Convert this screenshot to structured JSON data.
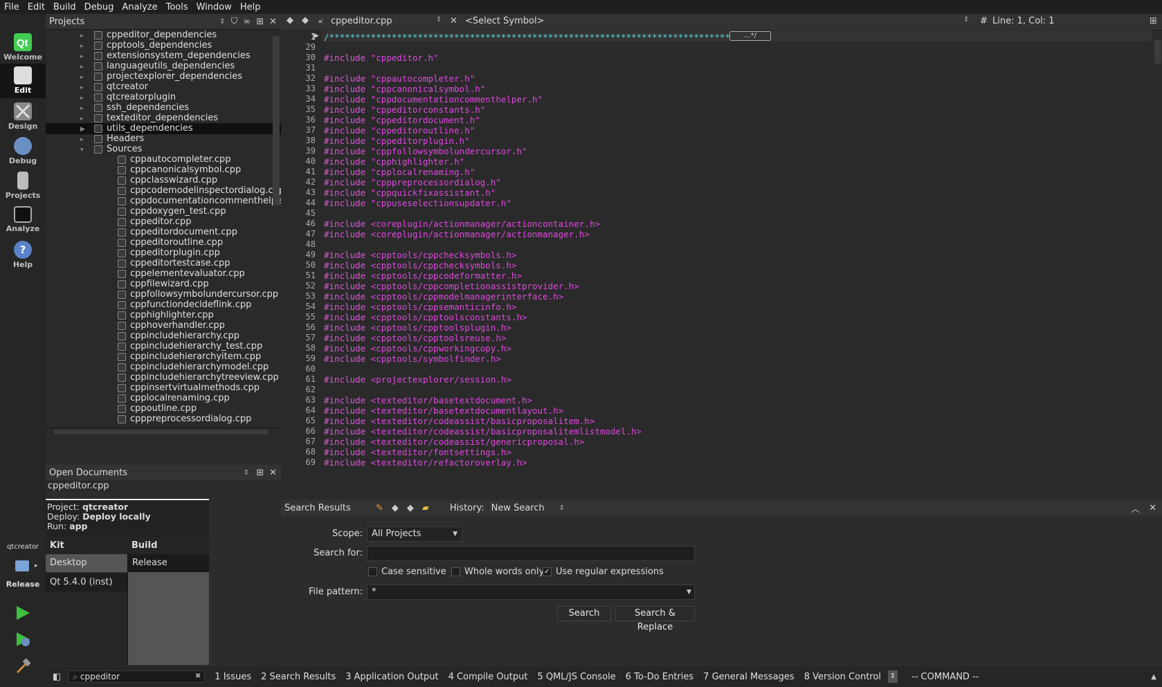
{
  "menu": [
    "File",
    "Edit",
    "Build",
    "Debug",
    "Analyze",
    "Tools",
    "Window",
    "Help"
  ],
  "modes": [
    {
      "label": "Welcome",
      "icon": "qt-logo-icon"
    },
    {
      "label": "Edit",
      "icon": "edit-document-icon"
    },
    {
      "label": "Design",
      "icon": "design-tools-icon"
    },
    {
      "label": "Debug",
      "icon": "debug-bug-icon"
    },
    {
      "label": "Projects",
      "icon": "projects-icon"
    },
    {
      "label": "Analyze",
      "icon": "analyze-monitor-icon"
    },
    {
      "label": "Help",
      "icon": "help-icon"
    }
  ],
  "projects": {
    "title": "Projects",
    "tree": [
      {
        "label": "cppeditor_dependencies",
        "indent": 1,
        "arrow": "▸"
      },
      {
        "label": "cpptools_dependencies",
        "indent": 1,
        "arrow": "▸"
      },
      {
        "label": "extensionsystem_dependencies",
        "indent": 1,
        "arrow": "▸"
      },
      {
        "label": "languageutils_dependencies",
        "indent": 1,
        "arrow": "▸"
      },
      {
        "label": "projectexplorer_dependencies",
        "indent": 1,
        "arrow": "▸"
      },
      {
        "label": "qtcreator",
        "indent": 1,
        "arrow": "▸"
      },
      {
        "label": "qtcreatorplugin",
        "indent": 1,
        "arrow": "▸"
      },
      {
        "label": "ssh_dependencies",
        "indent": 1,
        "arrow": "▸"
      },
      {
        "label": "texteditor_dependencies",
        "indent": 1,
        "arrow": "▸"
      },
      {
        "label": "utils_dependencies",
        "indent": 1,
        "arrow": "▶",
        "selected": true
      },
      {
        "label": "Headers",
        "indent": 1,
        "arrow": "▸"
      },
      {
        "label": "Sources",
        "indent": 1,
        "arrow": "▾"
      },
      {
        "label": "cppautocompleter.cpp",
        "indent": 2
      },
      {
        "label": "cppcanonicalsymbol.cpp",
        "indent": 2
      },
      {
        "label": "cppclasswizard.cpp",
        "indent": 2
      },
      {
        "label": "cppcodemodelinspectordialog.cpp",
        "indent": 2
      },
      {
        "label": "cppdocumentationcommenthelper",
        "indent": 2
      },
      {
        "label": "cppdoxygen_test.cpp",
        "indent": 2
      },
      {
        "label": "cppeditor.cpp",
        "indent": 2
      },
      {
        "label": "cppeditordocument.cpp",
        "indent": 2
      },
      {
        "label": "cppeditoroutline.cpp",
        "indent": 2
      },
      {
        "label": "cppeditorplugin.cpp",
        "indent": 2
      },
      {
        "label": "cppeditortestcase.cpp",
        "indent": 2
      },
      {
        "label": "cppelementevaluator.cpp",
        "indent": 2
      },
      {
        "label": "cppfilewizard.cpp",
        "indent": 2
      },
      {
        "label": "cppfollowsymbolundercursor.cpp",
        "indent": 2
      },
      {
        "label": "cppfunctiondecldeflink.cpp",
        "indent": 2
      },
      {
        "label": "cpphighlighter.cpp",
        "indent": 2
      },
      {
        "label": "cpphoverhandler.cpp",
        "indent": 2
      },
      {
        "label": "cppincludehierarchy.cpp",
        "indent": 2
      },
      {
        "label": "cppincludehierarchy_test.cpp",
        "indent": 2
      },
      {
        "label": "cppincludehierarchyitem.cpp",
        "indent": 2
      },
      {
        "label": "cppincludehierarchymodel.cpp",
        "indent": 2
      },
      {
        "label": "cppincludehierarchytreeview.cpp",
        "indent": 2
      },
      {
        "label": "cppinsertvirtualmethods.cpp",
        "indent": 2
      },
      {
        "label": "cpplocalrenaming.cpp",
        "indent": 2
      },
      {
        "label": "cppoutline.cpp",
        "indent": 2
      },
      {
        "label": "cpppreprocessordialog.cpp",
        "indent": 2
      }
    ]
  },
  "open_documents": {
    "title": "Open Documents",
    "items": [
      "cppeditor.cpp"
    ]
  },
  "kit_popup": {
    "project_label": "Project:",
    "project": "qtcreator",
    "deploy_label": "Deploy:",
    "deploy": "Deploy locally",
    "run_label": "Run:",
    "run": "app",
    "kit_header": "Kit",
    "build_header": "Build",
    "kits": [
      "Desktop",
      "Qt 5.4.0 (inst)"
    ],
    "builds": [
      "Release"
    ]
  },
  "target_selector": {
    "project": "qtcreator",
    "build": "Release"
  },
  "editor": {
    "file": "cppeditor.cpp",
    "symbol": "<Select Symbol>",
    "position": "Line: 1, Col: 1",
    "hash": "#",
    "lines": [
      {
        "n": "1",
        "code": "/*****************************************************************************",
        "kw": ""
      },
      {
        "n": "29",
        "code": "",
        "kw": ""
      },
      {
        "n": "30",
        "kw": "#include",
        "code": " \"cppeditor.h\""
      },
      {
        "n": "31",
        "code": "",
        "kw": ""
      },
      {
        "n": "32",
        "kw": "#include",
        "code": " \"cppautocompleter.h\""
      },
      {
        "n": "33",
        "kw": "#include",
        "code": " \"cppcanonicalsymbol.h\""
      },
      {
        "n": "34",
        "kw": "#include",
        "code": " \"cppdocumentationcommenthelper.h\""
      },
      {
        "n": "35",
        "kw": "#include",
        "code": " \"cppeditorconstants.h\""
      },
      {
        "n": "36",
        "kw": "#include",
        "code": " \"cppeditordocument.h\""
      },
      {
        "n": "37",
        "kw": "#include",
        "code": " \"cppeditoroutline.h\""
      },
      {
        "n": "38",
        "kw": "#include",
        "code": " \"cppeditorplugin.h\""
      },
      {
        "n": "39",
        "kw": "#include",
        "code": " \"cppfollowsymbolundercursor.h\""
      },
      {
        "n": "40",
        "kw": "#include",
        "code": " \"cpphighlighter.h\""
      },
      {
        "n": "41",
        "kw": "#include",
        "code": " \"cpplocalrenaming.h\""
      },
      {
        "n": "42",
        "kw": "#include",
        "code": " \"cpppreprocessordialog.h\""
      },
      {
        "n": "43",
        "kw": "#include",
        "code": " \"cppquickfixassistant.h\""
      },
      {
        "n": "44",
        "kw": "#include",
        "code": " \"cppuseselectionsupdater.h\""
      },
      {
        "n": "45",
        "code": "",
        "kw": ""
      },
      {
        "n": "46",
        "kw": "#include",
        "code": " <coreplugin/actionmanager/actioncontainer.h>"
      },
      {
        "n": "47",
        "kw": "#include",
        "code": " <coreplugin/actionmanager/actionmanager.h>"
      },
      {
        "n": "48",
        "code": "",
        "kw": ""
      },
      {
        "n": "49",
        "kw": "#include",
        "code": " <cpptools/cppchecksymbols.h>"
      },
      {
        "n": "50",
        "kw": "#include",
        "code": " <cpptools/cppchecksymbols.h>"
      },
      {
        "n": "51",
        "kw": "#include",
        "code": " <cpptools/cppcodeformatter.h>"
      },
      {
        "n": "52",
        "kw": "#include",
        "code": " <cpptools/cppcompletionassistprovider.h>"
      },
      {
        "n": "53",
        "kw": "#include",
        "code": " <cpptools/cppmodelmanagerinterface.h>"
      },
      {
        "n": "54",
        "kw": "#include",
        "code": " <cpptools/cppsemanticinfo.h>"
      },
      {
        "n": "55",
        "kw": "#include",
        "code": " <cpptools/cpptoolsconstants.h>"
      },
      {
        "n": "56",
        "kw": "#include",
        "code": " <cpptools/cpptoolsplugin.h>"
      },
      {
        "n": "57",
        "kw": "#include",
        "code": " <cpptools/cpptoolsreuse.h>"
      },
      {
        "n": "58",
        "kw": "#include",
        "code": " <cpptools/cppworkingcopy.h>"
      },
      {
        "n": "59",
        "kw": "#include",
        "code": " <cpptools/symbolfinder.h>"
      },
      {
        "n": "60",
        "code": "",
        "kw": ""
      },
      {
        "n": "61",
        "kw": "#include",
        "code": " <projectexplorer/session.h>"
      },
      {
        "n": "62",
        "code": "",
        "kw": ""
      },
      {
        "n": "63",
        "kw": "#include",
        "code": " <texteditor/basetextdocument.h>"
      },
      {
        "n": "64",
        "kw": "#include",
        "code": " <texteditor/basetextdocumentlayout.h>"
      },
      {
        "n": "65",
        "kw": "#include",
        "code": " <texteditor/codeassist/basicproposalitem.h>"
      },
      {
        "n": "66",
        "kw": "#include",
        "code": " <texteditor/codeassist/basicproposalitemlistmodel.h>"
      },
      {
        "n": "67",
        "kw": "#include",
        "code": " <texteditor/codeassist/genericproposal.h>"
      },
      {
        "n": "68",
        "kw": "#include",
        "code": " <texteditor/fontsettings.h>"
      },
      {
        "n": "69",
        "kw": "#include",
        "code": " <texteditor/refactoroverlay.h>"
      }
    ],
    "fold_marker": "...*/"
  },
  "search": {
    "title": "Search Results",
    "history_label": "History:",
    "history_value": "New Search",
    "scope_label": "Scope:",
    "scope_value": "All Projects",
    "search_for_label": "Search for:",
    "search_for_value": "",
    "case_sensitive": "Case sensitive",
    "whole_words": "Whole words only",
    "use_regex": "Use regular expressions",
    "regex_checked": "✓",
    "file_pattern_label": "File pattern:",
    "file_pattern_value": "*",
    "search_btn": "Search",
    "search_replace_btn": "Search & Replace"
  },
  "statusbar": {
    "locator_value": "cppeditor",
    "panes": [
      "1  Issues",
      "2  Search Results",
      "3  Application Output",
      "4  Compile Output",
      "5  QML/JS Console",
      "6  To-Do Entries",
      "7  General Messages",
      "8  Version Control"
    ],
    "mode_text": "-- COMMAND --"
  },
  "colors": {
    "accent_green": "#3fbf3f",
    "include_kw": "#d65cd6",
    "string": "#e049e0",
    "comment": "#5fd7d7"
  }
}
